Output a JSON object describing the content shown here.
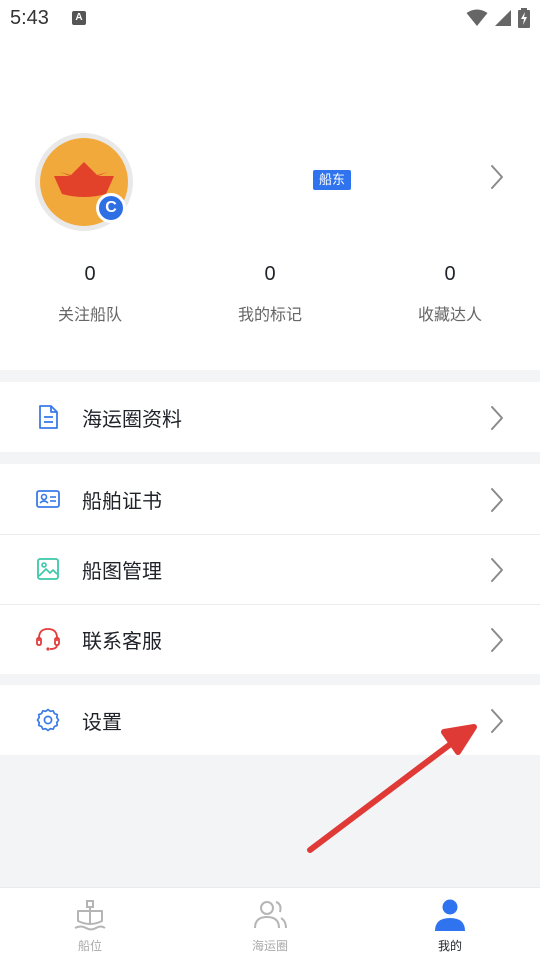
{
  "status_bar": {
    "time": "5:43",
    "notification_icon": "A"
  },
  "profile": {
    "avatar_badge": "C",
    "role_tag": "船东",
    "stats": [
      {
        "value": "0",
        "label": "关注船队"
      },
      {
        "value": "0",
        "label": "我的标记"
      },
      {
        "value": "0",
        "label": "收藏达人"
      }
    ]
  },
  "menu": {
    "shipping_profile": "海运圈资料",
    "ship_certificate": "船舶证书",
    "ship_photo_management": "船图管理",
    "customer_service": "联系客服",
    "settings": "设置"
  },
  "tabbar": {
    "tabs": [
      {
        "label": "船位",
        "icon": "ship-icon",
        "active": false
      },
      {
        "label": "海运圈",
        "icon": "users-icon",
        "active": false
      },
      {
        "label": "我的",
        "icon": "person-icon",
        "active": true
      }
    ]
  },
  "colors": {
    "accent": "#2f74ee",
    "annotation_arrow": "#e03a36",
    "avatar_bg": "#f2a93b"
  }
}
